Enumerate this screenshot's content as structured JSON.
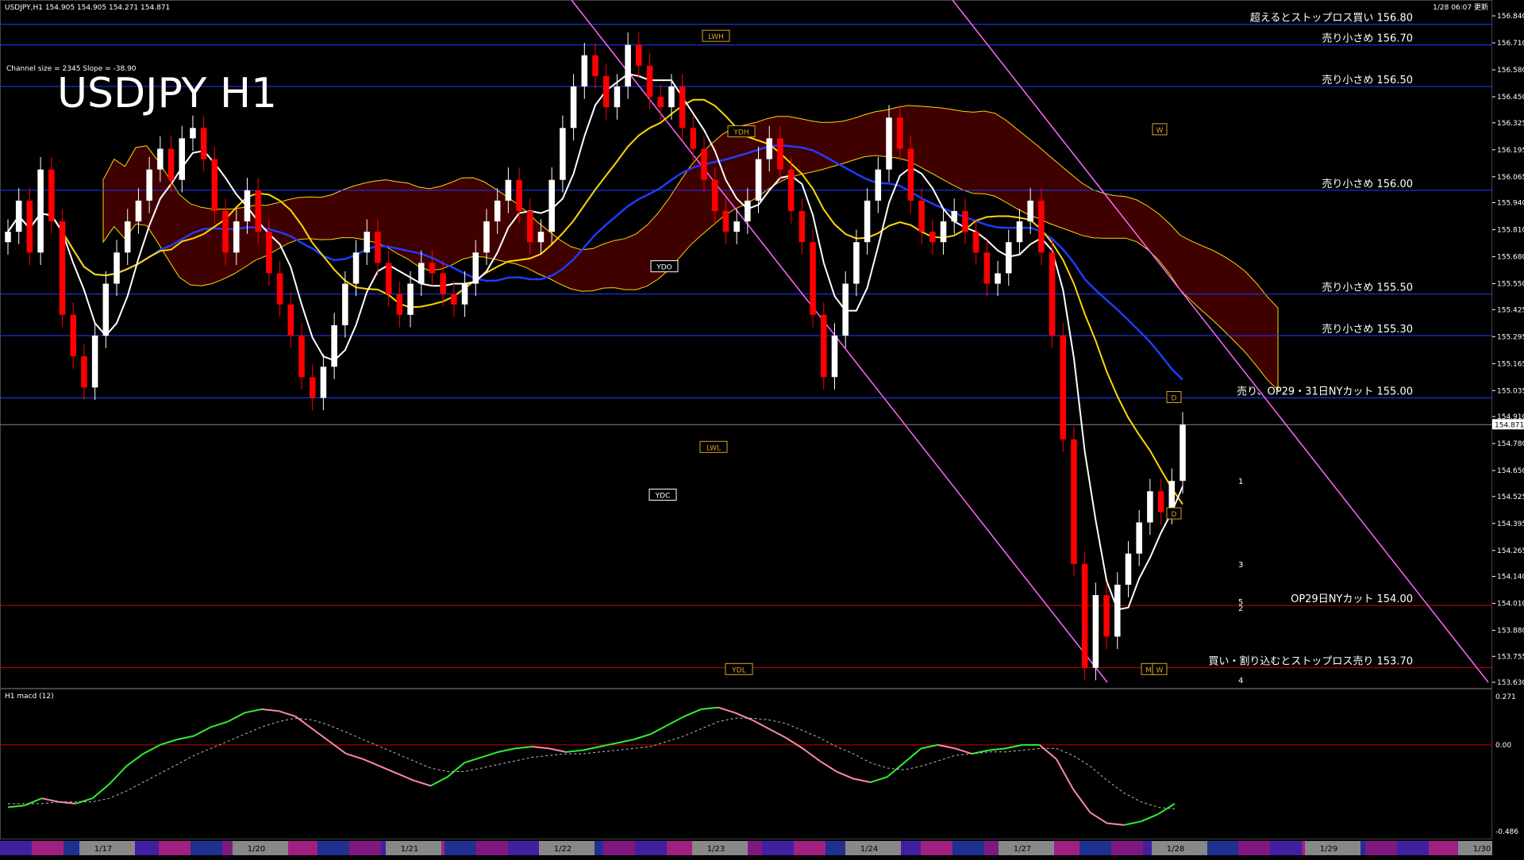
{
  "header": {
    "symbol_info": "USDJPY,H1  154.905 154.905 154.271 154.871",
    "updated": "1/28 06:07 更新",
    "channel_info": "Channel size = 2345 Slope = -38.90",
    "big_title": "USDJPY H1",
    "macd_title": "H1  macd (12)"
  },
  "colors": {
    "background": "#000000",
    "candle_up": "#ffffff",
    "candle_down": "#ff0000",
    "resistance_line": "#1e3cff",
    "support_line": "#cc0000",
    "cloud": "#b40000",
    "channel": "#ff66ff",
    "ma_white": "#ffffff",
    "ma_yellow": "#ffd700",
    "ma_blue": "#1e3cff",
    "chikou": "#33cc33",
    "macd_up": "#33ee33",
    "macd_down": "#ff88aa",
    "signal": "#bbbbbb"
  },
  "chart_data": {
    "type": "candlestick",
    "instrument": "USDJPY",
    "timeframe": "H1",
    "price_axis": {
      "min": 153.63,
      "max": 156.84,
      "ticks": [
        "156.840",
        "156.710",
        "156.580",
        "156.450",
        "156.325",
        "156.195",
        "156.065",
        "155.940",
        "155.810",
        "155.680",
        "155.550",
        "155.425",
        "155.295",
        "155.165",
        "155.035",
        "154.910",
        "154.780",
        "154.650",
        "154.525",
        "154.395",
        "154.265",
        "154.140",
        "154.010",
        "153.880",
        "153.755",
        "153.630"
      ],
      "current_price": "154.871"
    },
    "levels": [
      {
        "price": 156.8,
        "label": "超えるとストップロス買い 156.80",
        "color": "#1e3cff"
      },
      {
        "price": 156.7,
        "label": "売り小さめ 156.70",
        "color": "#1e3cff"
      },
      {
        "price": 156.5,
        "label": "売り小さめ 156.50",
        "color": "#1e3cff"
      },
      {
        "price": 156.0,
        "label": "売り小さめ 156.00",
        "color": "#1e3cff"
      },
      {
        "price": 155.5,
        "label": "売り小さめ 155.50",
        "color": "#1e3cff"
      },
      {
        "price": 155.3,
        "label": "売り小さめ 155.30",
        "color": "#1e3cff"
      },
      {
        "price": 155.0,
        "label": "売り、OP29・31日NYカット 155.00",
        "color": "#1e3cff"
      },
      {
        "price": 154.0,
        "label": "OP29日NYカット 154.00",
        "color": "#cc0000"
      },
      {
        "price": 153.7,
        "label": "買い・割り込むとストップロス売り 153.70",
        "color": "#cc0000"
      }
    ],
    "markers": [
      {
        "label": "LWH",
        "price": 156.74
      },
      {
        "label": "YDH",
        "price": 156.28
      },
      {
        "label": "W",
        "price": 156.29
      },
      {
        "label": "YDO",
        "price": 155.63
      },
      {
        "label": "LWL",
        "price": 154.76
      },
      {
        "label": "YDC",
        "price": 154.53
      },
      {
        "label": "YDL",
        "price": 153.69
      },
      {
        "label": "D",
        "price": 155.0
      },
      {
        "label": "D",
        "price": 154.44
      },
      {
        "label": "M",
        "price": 153.69
      },
      {
        "label": "W",
        "price": 153.69
      }
    ],
    "projection_labels": [
      "1",
      "3",
      "5",
      "2",
      "4"
    ],
    "close": [
      155.8,
      155.95,
      155.7,
      156.1,
      155.85,
      155.4,
      155.2,
      155.05,
      155.3,
      155.55,
      155.7,
      155.85,
      155.95,
      156.1,
      156.2,
      156.05,
      156.25,
      156.3,
      156.15,
      155.9,
      155.7,
      155.85,
      156.0,
      155.8,
      155.6,
      155.45,
      155.3,
      155.1,
      155.0,
      155.15,
      155.35,
      155.55,
      155.7,
      155.8,
      155.65,
      155.5,
      155.4,
      155.55,
      155.65,
      155.6,
      155.5,
      155.45,
      155.55,
      155.7,
      155.85,
      155.95,
      156.05,
      155.9,
      155.75,
      155.8,
      156.05,
      156.3,
      156.5,
      156.65,
      156.55,
      156.4,
      156.5,
      156.7,
      156.6,
      156.45,
      156.4,
      156.5,
      156.3,
      156.2,
      156.05,
      155.9,
      155.8,
      155.85,
      155.95,
      156.15,
      156.25,
      156.1,
      155.9,
      155.75,
      155.4,
      155.1,
      155.3,
      155.55,
      155.75,
      155.95,
      156.1,
      156.35,
      156.2,
      155.95,
      155.8,
      155.75,
      155.85,
      155.9,
      155.8,
      155.7,
      155.55,
      155.6,
      155.75,
      155.85,
      155.95,
      155.7,
      155.3,
      154.8,
      154.2,
      153.7,
      154.05,
      153.85,
      154.1,
      154.25,
      154.4,
      154.55,
      154.45,
      154.6,
      154.871
    ],
    "x_range": [
      "1/17",
      "1/30"
    ],
    "date_ticks": [
      "1/17",
      "1/20",
      "1/21",
      "1/22",
      "1/23",
      "1/24",
      "1/27",
      "1/28",
      "1/29",
      "1/30"
    ],
    "macd": {
      "title": "H1  macd (12)",
      "axis_ticks": [
        "0.271",
        "0.00",
        "-0.486"
      ],
      "ylim": [
        -0.486,
        0.271
      ],
      "values": [
        -0.35,
        -0.34,
        -0.3,
        -0.32,
        -0.33,
        -0.3,
        -0.22,
        -0.12,
        -0.05,
        0.0,
        0.03,
        0.05,
        0.1,
        0.13,
        0.18,
        0.2,
        0.19,
        0.16,
        0.09,
        0.02,
        -0.05,
        -0.08,
        -0.12,
        -0.16,
        -0.2,
        -0.23,
        -0.18,
        -0.1,
        -0.07,
        -0.04,
        -0.02,
        -0.01,
        -0.02,
        -0.04,
        -0.03,
        -0.01,
        0.01,
        0.03,
        0.06,
        0.11,
        0.16,
        0.2,
        0.21,
        0.18,
        0.14,
        0.09,
        0.04,
        -0.02,
        -0.09,
        -0.15,
        -0.19,
        -0.21,
        -0.18,
        -0.1,
        -0.02,
        0.0,
        -0.02,
        -0.05,
        -0.03,
        -0.02,
        0.0,
        0.0,
        -0.08,
        -0.25,
        -0.38,
        -0.44,
        -0.45,
        -0.43,
        -0.39,
        -0.33
      ],
      "signal": [
        -0.33,
        -0.33,
        -0.33,
        -0.32,
        -0.32,
        -0.32,
        -0.3,
        -0.26,
        -0.21,
        -0.16,
        -0.11,
        -0.06,
        -0.02,
        0.02,
        0.06,
        0.1,
        0.13,
        0.15,
        0.14,
        0.11,
        0.07,
        0.03,
        -0.01,
        -0.05,
        -0.09,
        -0.13,
        -0.15,
        -0.15,
        -0.13,
        -0.11,
        -0.09,
        -0.07,
        -0.06,
        -0.05,
        -0.05,
        -0.04,
        -0.03,
        -0.02,
        -0.01,
        0.02,
        0.05,
        0.09,
        0.13,
        0.15,
        0.15,
        0.14,
        0.12,
        0.08,
        0.04,
        -0.01,
        -0.05,
        -0.1,
        -0.13,
        -0.14,
        -0.12,
        -0.09,
        -0.06,
        -0.05,
        -0.04,
        -0.04,
        -0.03,
        -0.02,
        -0.02,
        -0.06,
        -0.12,
        -0.2,
        -0.27,
        -0.32,
        -0.35,
        -0.36
      ]
    }
  }
}
